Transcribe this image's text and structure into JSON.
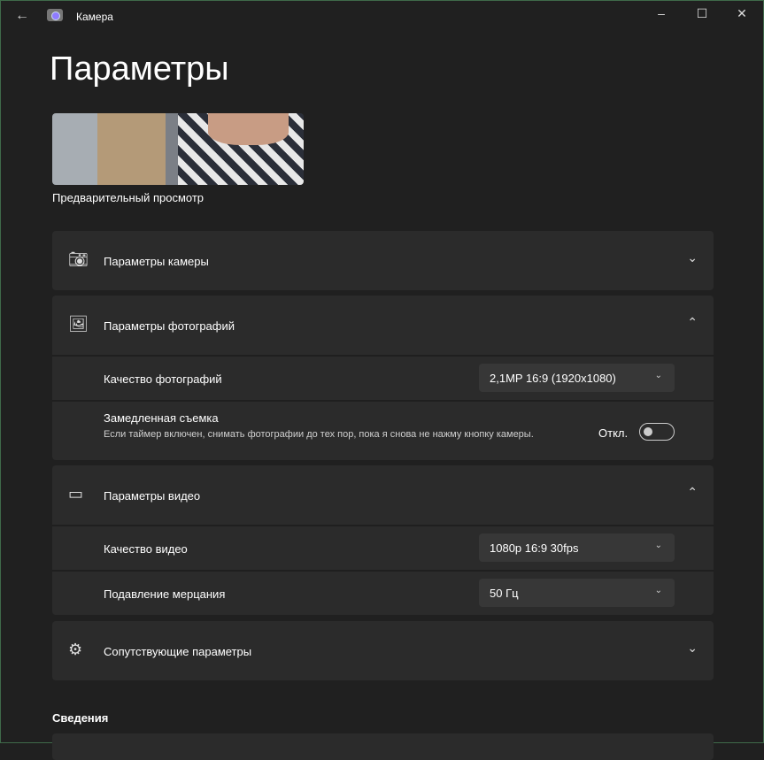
{
  "window": {
    "title": "Камера",
    "back_icon": "arrow-left-icon",
    "minimize": "–",
    "maximize": "☐",
    "close": "✕"
  },
  "page": {
    "title": "Параметры",
    "preview_label": "Предварительный просмотр",
    "section_info": "Сведения"
  },
  "camera": {
    "label": "Параметры камеры",
    "expanded": false
  },
  "photo": {
    "label": "Параметры фотографий",
    "expanded": true,
    "quality_label": "Качество фотографий",
    "quality_value": "2,1MP 16:9 (1920x1080)",
    "timelapse_label": "Замедленная съемка",
    "timelapse_desc": "Если таймер включен, снимать фотографии до тех пор, пока я снова не нажму кнопку камеры.",
    "timelapse_state": "Откл."
  },
  "video": {
    "label": "Параметры видео",
    "expanded": true,
    "quality_label": "Качество видео",
    "quality_value": "1080p 16:9 30fps",
    "flicker_label": "Подавление мерцания",
    "flicker_value": "50 Гц"
  },
  "related": {
    "label": "Сопутствующие параметры",
    "expanded": false
  }
}
